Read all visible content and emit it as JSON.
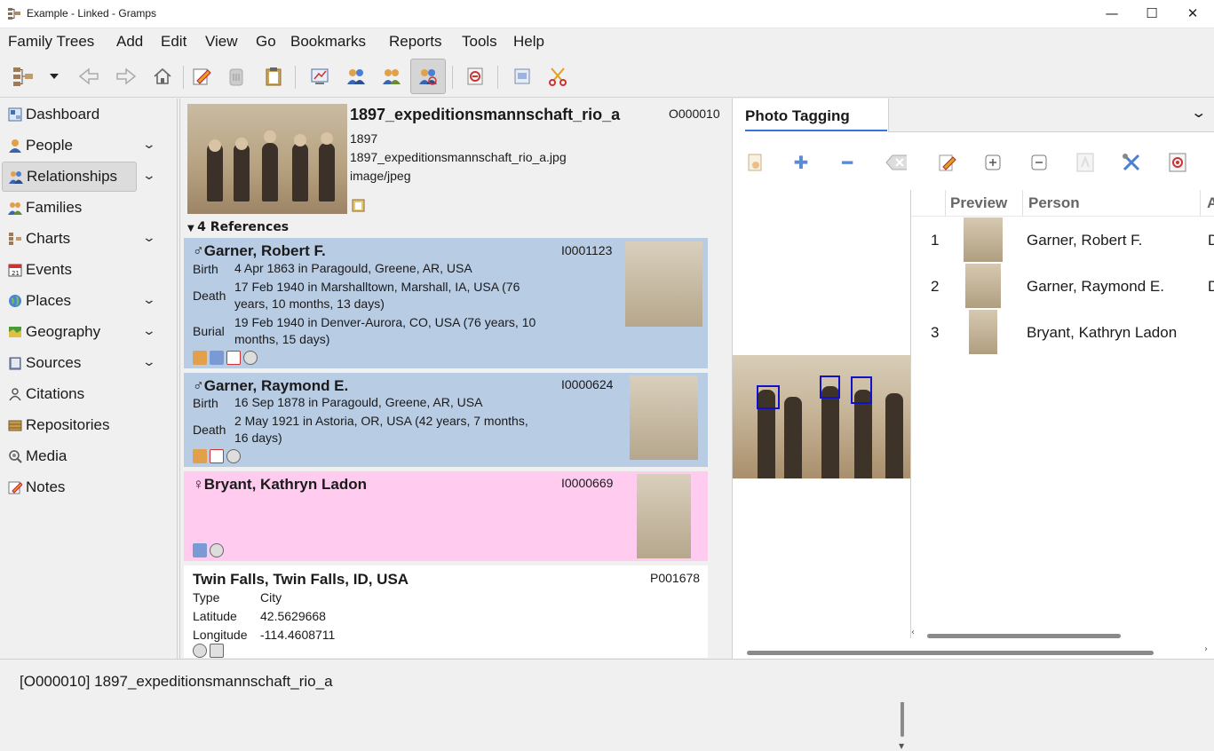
{
  "window": {
    "title": "Example - Linked - Gramps",
    "minimize": "—",
    "maximize": "☐",
    "close": "✕"
  },
  "menu": [
    "Family Trees",
    "Add",
    "Edit",
    "View",
    "Go",
    "Bookmarks",
    "Reports",
    "Tools",
    "Help"
  ],
  "sidebar": {
    "items": [
      {
        "label": "Dashboard",
        "icon": "dashboard-icon",
        "chevron": false
      },
      {
        "label": "People",
        "icon": "person-icon",
        "chevron": true
      },
      {
        "label": "Relationships",
        "icon": "relationships-icon",
        "chevron": true,
        "active": true
      },
      {
        "label": "Families",
        "icon": "family-icon",
        "chevron": false
      },
      {
        "label": "Charts",
        "icon": "chart-icon",
        "chevron": true
      },
      {
        "label": "Events",
        "icon": "calendar-icon",
        "chevron": false
      },
      {
        "label": "Places",
        "icon": "globe-icon",
        "chevron": true
      },
      {
        "label": "Geography",
        "icon": "map-icon",
        "chevron": true
      },
      {
        "label": "Sources",
        "icon": "book-icon",
        "chevron": true
      },
      {
        "label": "Citations",
        "icon": "citation-icon",
        "chevron": false
      },
      {
        "label": "Repositories",
        "icon": "repository-icon",
        "chevron": false
      },
      {
        "label": "Media",
        "icon": "media-icon",
        "chevron": false
      },
      {
        "label": "Notes",
        "icon": "note-icon",
        "chevron": false
      }
    ]
  },
  "media": {
    "title": "1897_expeditionsmannschaft_rio_a",
    "id": "O000010",
    "date": "1897",
    "file": "1897_expeditionsmannschaft_rio_a.jpg",
    "mime": "image/jpeg"
  },
  "references": {
    "header": "4 References",
    "people": [
      {
        "symbol": "♂",
        "name": "Garner, Robert F.",
        "id": "I0001123",
        "color": "#b8cce4",
        "events": [
          {
            "label": "Birth",
            "value": "4 Apr 1863 in Paragould, Greene, AR, USA"
          },
          {
            "label": "Death",
            "value": "17 Feb 1940 in Marshalltown, Marshall, IA, USA (76 years, 10 months, 13 days)"
          },
          {
            "label": "Burial",
            "value": "19 Feb 1940 in Denver-Aurora, CO, USA (76 years, 10 months, 15 days)"
          }
        ]
      },
      {
        "symbol": "♂",
        "name": "Garner, Raymond E.",
        "id": "I0000624",
        "color": "#b8cce4",
        "events": [
          {
            "label": "Birth",
            "value": "16 Sep 1878 in Paragould, Greene, AR, USA"
          },
          {
            "label": "Death",
            "value": "2 May 1921 in Astoria, OR, USA (42 years, 7 months, 16 days)"
          }
        ]
      },
      {
        "symbol": "♀",
        "name": "Bryant, Kathryn Ladon",
        "id": "I0000669",
        "color": "#ffccf0",
        "events": []
      }
    ],
    "place": {
      "name": "Twin Falls, Twin Falls, ID, USA",
      "id": "P001678",
      "type_label": "Type",
      "type": "City",
      "lat_label": "Latitude",
      "lat": "42.5629668",
      "lon_label": "Longitude",
      "lon": "-114.4608711"
    }
  },
  "photo_tagging": {
    "tab": "Photo Tagging",
    "columns": [
      "Preview",
      "Person",
      "A"
    ],
    "rows": [
      {
        "num": "1",
        "person": "Garner, Robert F.",
        "cut": "D"
      },
      {
        "num": "2",
        "person": "Garner, Raymond E.",
        "cut": "D"
      },
      {
        "num": "3",
        "person": "Bryant, Kathryn Ladon",
        "cut": ""
      }
    ]
  },
  "status": "[O000010] 1897_expeditionsmannschaft_rio_a"
}
